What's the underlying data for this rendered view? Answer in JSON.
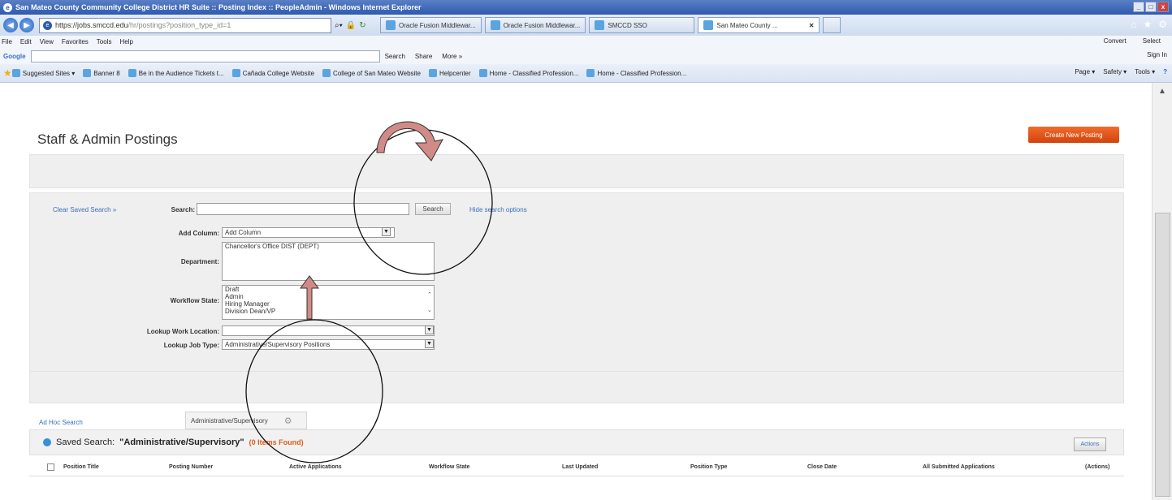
{
  "window": {
    "title": "San Mateo County Community College District HR Suite :: Posting Index :: PeopleAdmin - Windows Internet Explorer",
    "controls": [
      "_",
      "□",
      "x"
    ]
  },
  "browser": {
    "address_prefix": "https://",
    "address_domain": "jobs.smccd.edu",
    "address_path": "/hr/postings?position_type_id=1",
    "tabs": [
      {
        "label": "Oracle Fusion Middlewar..."
      },
      {
        "label": "Oracle Fusion Middlewar..."
      },
      {
        "label": "SMCCD SSO"
      },
      {
        "label": "San Mateo County ..."
      }
    ],
    "menu": [
      "File",
      "Edit",
      "View",
      "Favorites",
      "Tools",
      "Help"
    ],
    "menu_right": [
      "Convert",
      "Select"
    ],
    "google_label": "Google",
    "google_search": "Search",
    "google_share": "Share",
    "google_more": "More »",
    "sign_in": "Sign In",
    "favorites": [
      "Suggested Sites ▾",
      "Banner 8",
      "Be in the Audience Tickets t...",
      "Cañada College Website",
      "College of San Mateo Website",
      "Helpcenter",
      "Home - Classified Profession...",
      "Home - Classified Profession..."
    ],
    "tools": [
      "Page ▾",
      "Safety ▾",
      "Tools ▾"
    ]
  },
  "page": {
    "title": "Staff & Admin Postings",
    "create_button": "Create New Posting",
    "clear_saved_search": "Clear Saved Search »",
    "search_label": "Search:",
    "search_button": "Search",
    "hide_options": "Hide search options",
    "add_column_label": "Add Column:",
    "add_column_value": "Add Column",
    "department_label": "Department:",
    "department_options": [
      "Chancellor's Office DIST (DEPT)"
    ],
    "workflow_label": "Workflow State:",
    "workflow_options": [
      "Draft",
      "Admin",
      "Hiring Manager",
      "Division Dean/VP"
    ],
    "work_location_label": "Lookup Work Location:",
    "job_type_label": "Lookup Job Type:",
    "job_type_value": "Administrative/Supervisory Positions",
    "adhoc_tab": "Ad Hoc Search",
    "saved_tab": "Administrative/Supervisory",
    "saved_search_prefix": "Saved Search:",
    "saved_search_name": "\"Administrative/Supervisory\"",
    "saved_search_count": "(0 Items Found)",
    "actions_button": "Actions",
    "columns": [
      "Position Title",
      "Posting Number",
      "Active Applications",
      "Workflow State",
      "Last Updated",
      "Position Type",
      "Close Date",
      "All Submitted Applications",
      "(Actions)"
    ]
  },
  "colors": {
    "accent": "#e25a1c",
    "link": "#3a6fb8",
    "annotation_arrow": "#d18b86"
  }
}
